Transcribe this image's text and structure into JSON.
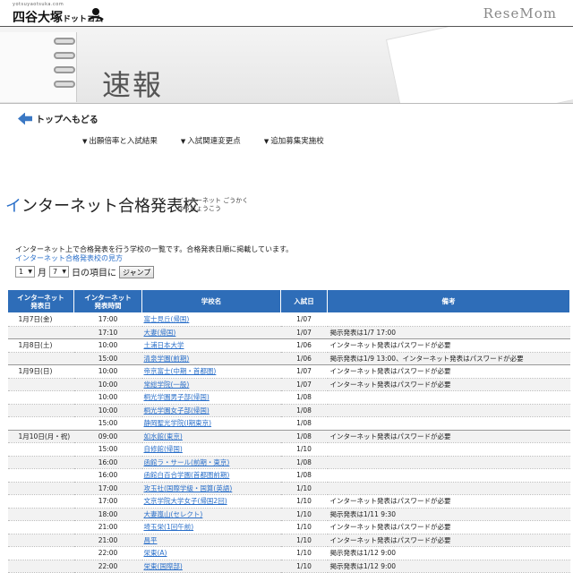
{
  "header": {
    "logo_small": "yotsuyaotsuka.com",
    "logo_main": "四谷大塚",
    "logo_dotcom": "ドットコム",
    "brand": "ReseMom"
  },
  "banner": {
    "title": "速報"
  },
  "nav": {
    "back": "トップへもどる",
    "sub": [
      "出願倍率と入試結果",
      "入試関連変更点",
      "追加募集実施校"
    ]
  },
  "section": {
    "title_first": "イ",
    "title_rest": "ンターネット合格発表校",
    "ruby_line1": "インターネット ごうかく",
    "ruby_line2": "はっぴょうこう",
    "description": "インターネット上で合格発表を行う学校の一覧です。合格発表日順に掲載しています。",
    "help_link": "インターネット合格発表校の見方"
  },
  "jump": {
    "month_value": "1",
    "month_label": "月",
    "day_value": "7",
    "day_label": "日の項目に",
    "button": "ジャンプ"
  },
  "table": {
    "headers": [
      "インターネット\n発表日",
      "インターネット\n発表時間",
      "学校名",
      "入試日",
      "備考"
    ],
    "rows": [
      {
        "date": "1月7日(金)",
        "time": "17:00",
        "school": "富士見丘(帰国)",
        "exam": "1/07",
        "note": ""
      },
      {
        "date": "",
        "time": "17:10",
        "school": "大妻(帰国)",
        "exam": "1/07",
        "note": "掲示発表は1/7 17:00"
      },
      {
        "date": "1月8日(土)",
        "time": "10:00",
        "school": "土浦日本大学",
        "exam": "1/06",
        "note": "インターネット発表はパスワードが必要"
      },
      {
        "date": "",
        "time": "15:00",
        "school": "清泉学園(前期)",
        "exam": "1/06",
        "note": "掲示発表は1/9 13:00、インターネット発表はパスワードが必要"
      },
      {
        "date": "1月9日(日)",
        "time": "10:00",
        "school": "帝京富士(中期・首都圏)",
        "exam": "1/07",
        "note": "インターネット発表はパスワードが必要"
      },
      {
        "date": "",
        "time": "10:00",
        "school": "常総学院(一般)",
        "exam": "1/07",
        "note": "インターネット発表はパスワードが必要"
      },
      {
        "date": "",
        "time": "10:00",
        "school": "桐光学園男子部(帰国)",
        "exam": "1/08",
        "note": ""
      },
      {
        "date": "",
        "time": "10:00",
        "school": "桐光学園女子部(帰国)",
        "exam": "1/08",
        "note": ""
      },
      {
        "date": "",
        "time": "15:00",
        "school": "静岡聖光学院(Ⅰ期東京)",
        "exam": "1/08",
        "note": ""
      },
      {
        "date": "1月10日(月・祝)",
        "time": "09:00",
        "school": "如水館(東京)",
        "exam": "1/08",
        "note": "インターネット発表はパスワードが必要"
      },
      {
        "date": "",
        "time": "15:00",
        "school": "自修館(帰国)",
        "exam": "1/10",
        "note": ""
      },
      {
        "date": "",
        "time": "16:00",
        "school": "函館ラ・サール(前期・東京)",
        "exam": "1/08",
        "note": ""
      },
      {
        "date": "",
        "time": "16:00",
        "school": "函館白百合学園(首都圏前期)",
        "exam": "1/08",
        "note": ""
      },
      {
        "date": "",
        "time": "17:00",
        "school": "攻玉社(国際学級・国算(英語)",
        "exam": "1/10",
        "note": ""
      },
      {
        "date": "",
        "time": "17:00",
        "school": "文京学院大学女子(帰国2回)",
        "exam": "1/10",
        "note": "インターネット発表はパスワードが必要"
      },
      {
        "date": "",
        "time": "18:00",
        "school": "大妻嵐山(セレクト)",
        "exam": "1/10",
        "note": "掲示発表は1/11 9:30"
      },
      {
        "date": "",
        "time": "21:00",
        "school": "埼玉栄(1回午前)",
        "exam": "1/10",
        "note": "インターネット発表はパスワードが必要"
      },
      {
        "date": "",
        "time": "21:00",
        "school": "昌平",
        "exam": "1/10",
        "note": "インターネット発表はパスワードが必要"
      },
      {
        "date": "",
        "time": "22:00",
        "school": "栄東(A)",
        "exam": "1/10",
        "note": "掲示発表は1/12 9:00"
      },
      {
        "date": "",
        "time": "22:00",
        "school": "栄東(国際部)",
        "exam": "1/10",
        "note": "掲示発表は1/12 9:00"
      }
    ]
  }
}
